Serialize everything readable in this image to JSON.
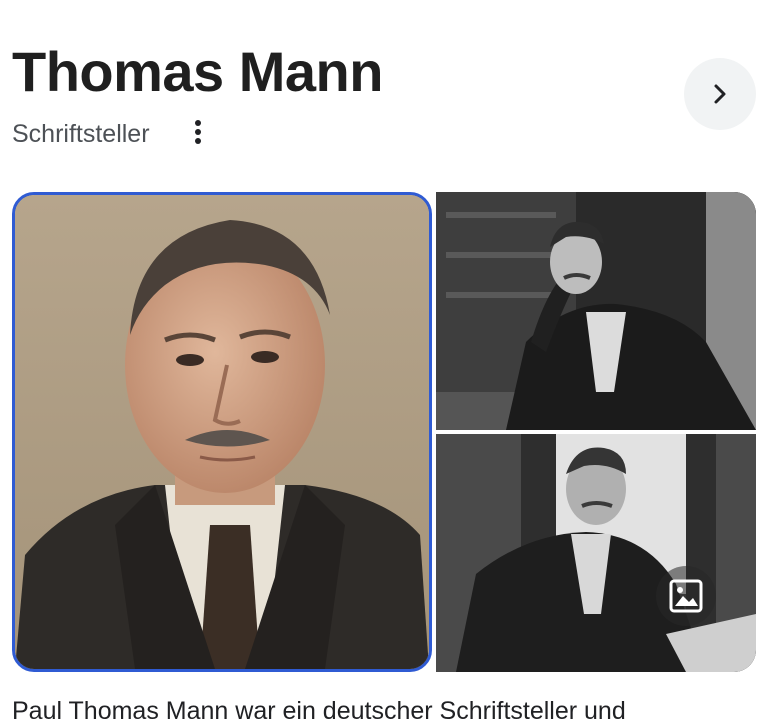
{
  "entity": {
    "title": "Thomas Mann",
    "subtitle": "Schriftsteller"
  },
  "icons": {
    "more": "more-vert-icon",
    "next": "chevron-right-icon",
    "images": "image-icon"
  },
  "photos": [
    {
      "label": "portrait-color",
      "selected": true
    },
    {
      "label": "seated-black-white"
    },
    {
      "label": "desk-black-white"
    }
  ],
  "description": "Paul Thomas Mann war ein deutscher Schriftsteller und",
  "colors": {
    "selection_border": "#2f5bd3",
    "button_bg": "#f1f3f4",
    "text": "#202124",
    "subtext": "#4d5156"
  }
}
